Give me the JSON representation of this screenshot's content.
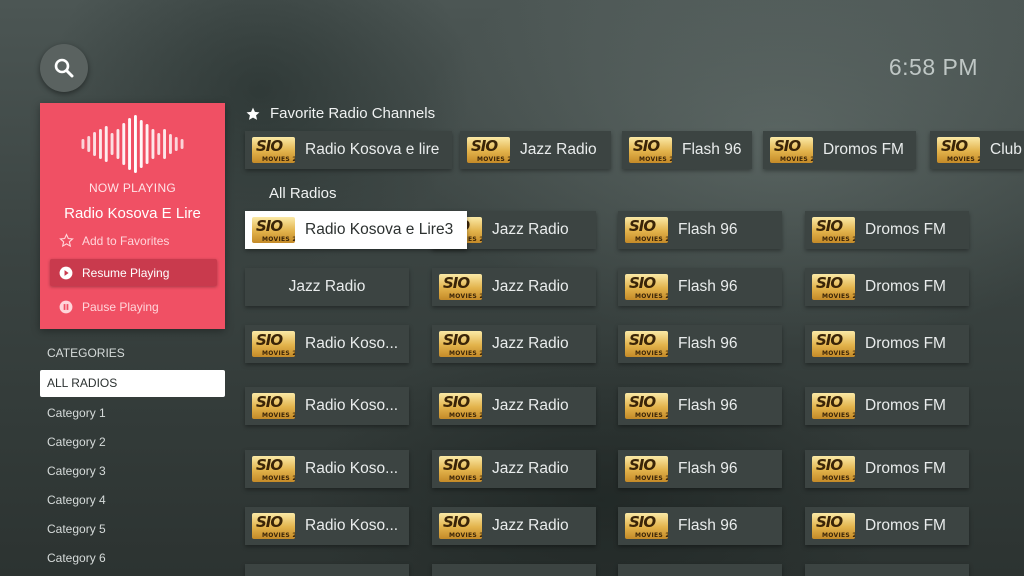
{
  "clock": "6:58 PM",
  "now_playing": {
    "label": "NOW PLAYING",
    "title": "Radio Kosova E Lire",
    "actions": [
      "Add to Favorites",
      "Resume Playing",
      "Pause Playing"
    ]
  },
  "categories": {
    "heading": "CATEGORIES",
    "items": [
      "ALL RADIOS",
      "Category 1",
      "Category 2",
      "Category 3",
      "Category 4",
      "Category 5",
      "Category 6"
    ]
  },
  "favorites": {
    "title": "Favorite Radio Channels",
    "items": [
      "Radio Kosova e lire",
      "Jazz Radio",
      "Flash 96",
      "Dromos FM",
      "Club"
    ]
  },
  "all_radios": {
    "title": "All Radios",
    "rows": [
      [
        "Radio Kosova e Lire3",
        "Jazz Radio",
        "Flash 96",
        "Dromos FM"
      ],
      [
        "Jazz Radio",
        "Jazz Radio",
        "Flash 96",
        "Dromos FM"
      ],
      [
        "Radio Koso...",
        "Jazz Radio",
        "Flash 96",
        "Dromos FM"
      ],
      [
        "Radio Koso...",
        "Jazz Radio",
        "Flash 96",
        "Dromos FM"
      ],
      [
        "Radio Koso...",
        "Jazz Radio",
        "Flash 96",
        "Dromos FM"
      ],
      [
        "Radio Koso...",
        "Jazz Radio",
        "Flash 96",
        "Dromos FM"
      ]
    ]
  },
  "logo": {
    "line1": "SIO",
    "line2": "MOVIES 2"
  },
  "colors": {
    "accent": "#f05064",
    "accent_dark": "#c93a4d",
    "tile": "#3c4442",
    "focus": "#ffffff"
  }
}
